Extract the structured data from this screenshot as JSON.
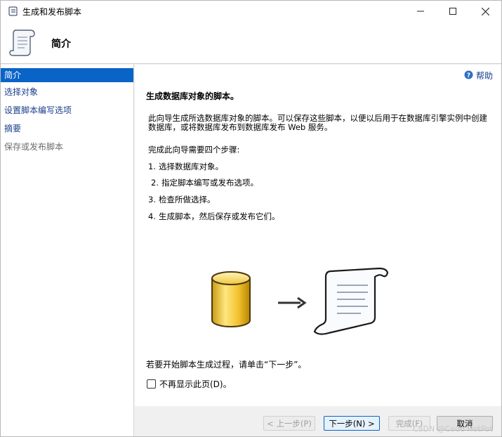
{
  "window": {
    "title": "生成和发布脚本",
    "app_icon": "script-scroll-icon"
  },
  "header": {
    "heading": "简介"
  },
  "sidebar": {
    "items": [
      {
        "label": "简介",
        "state": "selected"
      },
      {
        "label": "选择对象",
        "state": "link"
      },
      {
        "label": "设置脚本编写选项",
        "state": "link"
      },
      {
        "label": "摘要",
        "state": "link"
      },
      {
        "label": "保存或发布脚本",
        "state": "disabled"
      }
    ]
  },
  "content": {
    "help_label": "帮助",
    "section_title": "生成数据库对象的脚本。",
    "description": "此向导生成所选数据库对象的脚本。可以保存这些脚本，以便以后用于在数据库引擎实例中创建数据库，或将数据库发布到数据库发布 Web 服务。",
    "steps_intro": "完成此向导需要四个步骤:",
    "steps": [
      {
        "num": "1.",
        "text": "选择数据库对象。"
      },
      {
        "num": "2.",
        "text": "指定脚本编写或发布选项。"
      },
      {
        "num": "3.",
        "text": "检查所做选择。"
      },
      {
        "num": "4.",
        "text": "生成脚本，然后保存或发布它们。"
      }
    ],
    "start_text": "若要开始脚本生成过程，请单击“下一步”。",
    "dont_show_label": "不再显示此页(D)。",
    "dont_show_checked": false
  },
  "footer": {
    "prev_label": "< 上一步(P)",
    "next_label": "下一步(N) >",
    "finish_label": "完成(F)",
    "cancel_label": "取消"
  },
  "watermark": "CSDN @Code HotPot",
  "colors": {
    "selected_bg": "#0a64c8",
    "link": "#1a3e8c"
  }
}
